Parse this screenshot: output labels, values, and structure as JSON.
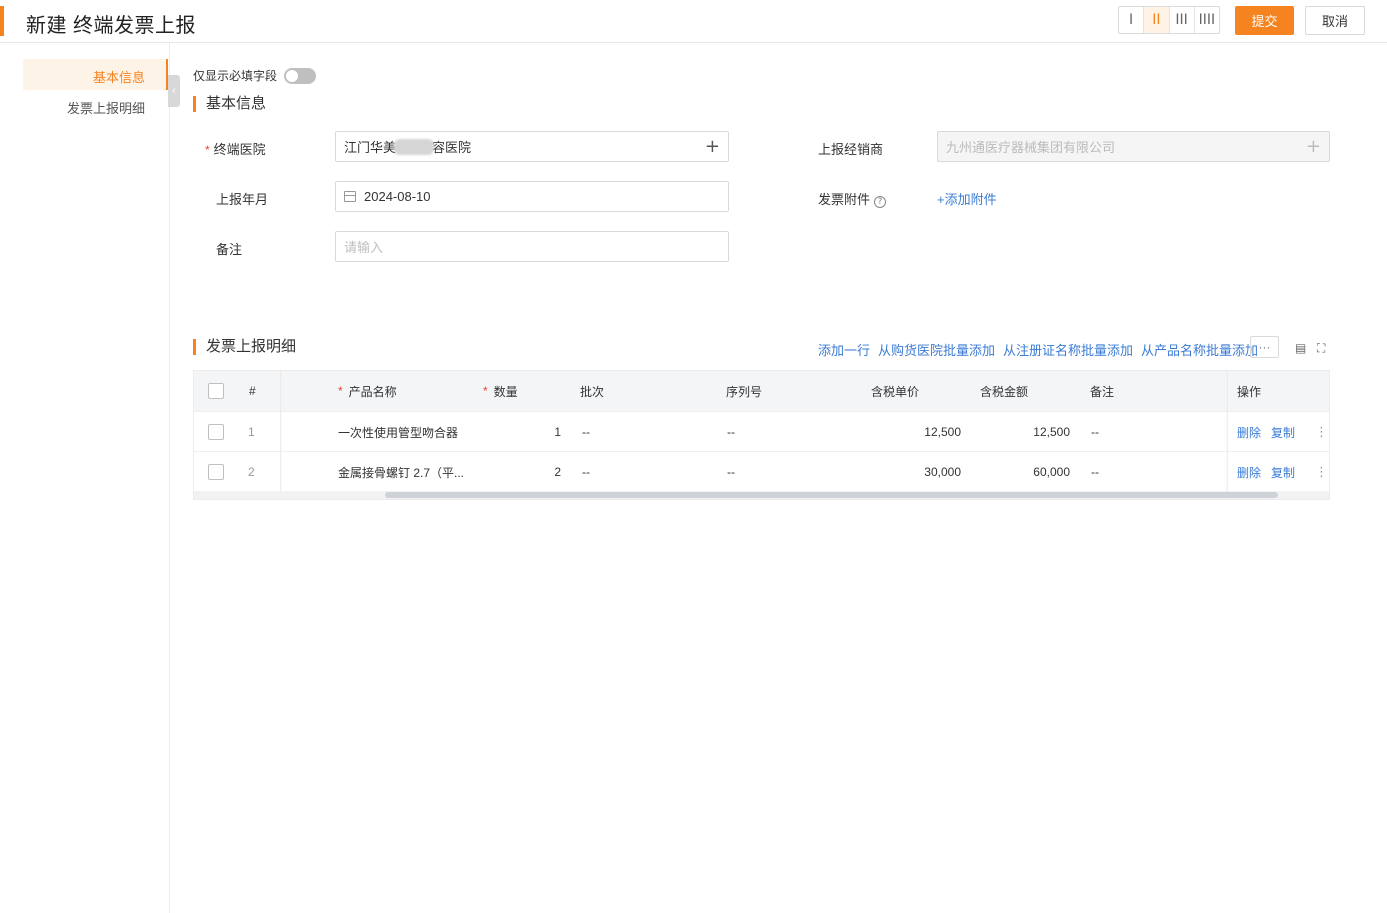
{
  "header": {
    "title": "新建 终端发票上报",
    "layout_options": [
      "I",
      "II",
      "III",
      "IIII"
    ],
    "layout_active": "II",
    "submit_label": "提交",
    "cancel_label": "取消",
    "accent_color": "#f5831f"
  },
  "nav": {
    "items": [
      {
        "label": "基本信息",
        "active": true
      },
      {
        "label": "发票上报明细",
        "active": false
      }
    ]
  },
  "required_toggle": {
    "label": "仅显示必填字段",
    "on": false
  },
  "basic": {
    "section_title": "基本信息",
    "hospital": {
      "label": "终端医院",
      "required": true,
      "value_prefix": "江门华美",
      "value_suffix": "容医院"
    },
    "distributor": {
      "label": "上报经销商",
      "value": "九州通医疗器械集团有限公司",
      "disabled": true
    },
    "report_month": {
      "label": "上报年月",
      "value": "2024-08-10"
    },
    "attachment": {
      "label": "发票附件",
      "add_label": "+添加附件",
      "help_icon": "question-circle-icon"
    },
    "remark": {
      "label": "备注",
      "placeholder": "请输入"
    }
  },
  "detail": {
    "section_title": "发票上报明细",
    "actions": [
      "添加一行",
      "从购货医院批量添加",
      "从注册证名称批量添加",
      "从产品名称批量添加"
    ],
    "more_label": "···",
    "columns": {
      "index": "#",
      "product": "产品名称",
      "qty": "数量",
      "batch": "批次",
      "serial": "序列号",
      "unit_price": "含税单价",
      "amount": "含税金额",
      "remark": "备注",
      "ops": "操作"
    },
    "rows": [
      {
        "index": "1",
        "product": "一次性使用管型吻合器",
        "qty": "1",
        "batch": "--",
        "serial": "--",
        "unit_price": "12,500",
        "amount": "12,500",
        "remark": "--"
      },
      {
        "index": "2",
        "product": "金属接骨螺钉 2.7（平...",
        "qty": "2",
        "batch": "--",
        "serial": "--",
        "unit_price": "30,000",
        "amount": "60,000",
        "remark": "--"
      }
    ],
    "delete_label": "删除",
    "copy_label": "复制"
  }
}
